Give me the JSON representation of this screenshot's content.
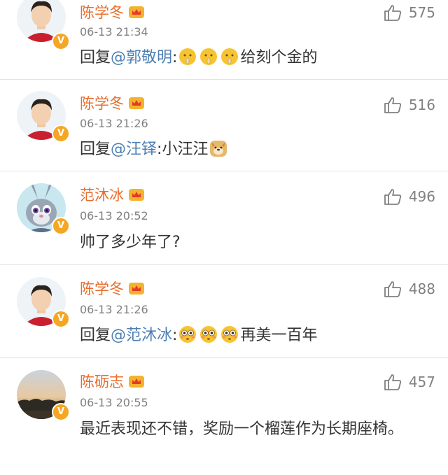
{
  "comments": [
    {
      "name": "陈学冬",
      "time": "06-13 21:34",
      "reply_prefix": "回复",
      "mention": "@郭敬明",
      "colon": ":",
      "emojis": [
        "shush-emoji",
        "shush-emoji",
        "shush-emoji"
      ],
      "text_after": "给刻个金的",
      "likes": "575",
      "avatar": "young-man-red-shirt"
    },
    {
      "name": "陈学冬",
      "time": "06-13 21:26",
      "reply_prefix": "回复",
      "mention": "@汪铎",
      "colon": ":小汪汪",
      "emojis": [
        "doge-emoji"
      ],
      "text_after": "",
      "likes": "516",
      "avatar": "young-man-red-shirt"
    },
    {
      "name": "范沐冰",
      "time": "06-13 20:52",
      "reply_prefix": "",
      "mention": "",
      "colon": "",
      "emojis": [],
      "text_after": "帅了多少年了?",
      "likes": "496",
      "avatar": "cartoon-bunny"
    },
    {
      "name": "陈学冬",
      "time": "06-13 21:26",
      "reply_prefix": "回复",
      "mention": "@范沐冰",
      "colon": ":",
      "emojis": [
        "flushed-emoji",
        "flushed-emoji",
        "flushed-emoji"
      ],
      "text_after": "再美一百年",
      "likes": "488",
      "avatar": "young-man-red-shirt"
    },
    {
      "name": "陈砺志",
      "time": "06-13 20:55",
      "reply_prefix": "",
      "mention": "",
      "colon": "",
      "emojis": [],
      "text_after": "最近表现还不错，奖励一个榴莲作为长期座椅。",
      "likes": "457",
      "avatar": "sunset-landscape"
    }
  ],
  "colors": {
    "name": "#e86e2d",
    "mention": "#4d7fb3",
    "badge": "#f5a623",
    "muted": "#808080"
  }
}
